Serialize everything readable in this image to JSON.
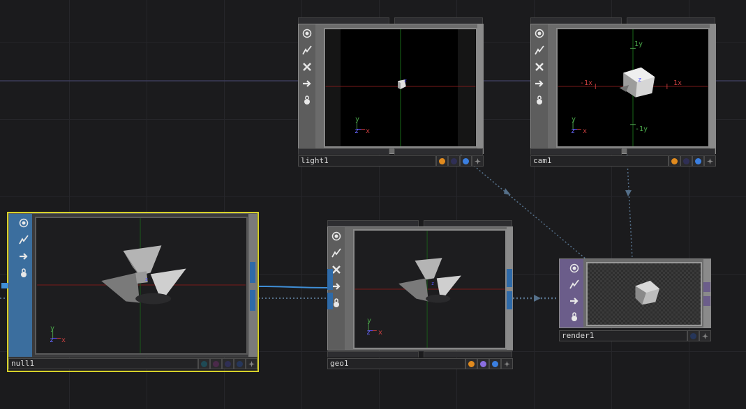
{
  "nodes": {
    "light1": {
      "name": "light1",
      "flags": {
        "colors": [
          "#e08a1e",
          "#2f2f55",
          "#3b7fe0"
        ]
      }
    },
    "cam1": {
      "name": "cam1",
      "flags": {
        "colors": [
          "#e08a1e",
          "#2f2f55",
          "#3b7fe0"
        ]
      }
    },
    "null1": {
      "name": "null1",
      "flags": {
        "colors": [
          "#1f4a55",
          "#4a2a4a",
          "#2f2f55",
          "#26365a"
        ]
      }
    },
    "geo1": {
      "name": "geo1",
      "flags": {
        "colors": [
          "#e08a1e",
          "#8a6ee0",
          "#3b7fe0"
        ]
      }
    },
    "render1": {
      "name": "render1",
      "flags": {
        "colors": [
          "#26365a"
        ]
      }
    }
  },
  "cam_view_labels": {
    "plus_y": "1y",
    "minus_y": "-1y",
    "plus_x": "1x",
    "minus_x": "-1x",
    "axis_z": "z"
  },
  "axis_gizmo": {
    "x": "x",
    "y": "y",
    "z": "z"
  },
  "sidebar_buttons": [
    "viewer-toggle-icon",
    "bypass-icon",
    "cook-off-icon",
    "export-arrow-icon",
    "lock-icon"
  ],
  "colors": {
    "accent_selected": "#d6d12a",
    "wire_blue": "#3f8ed6",
    "comp_render": "#6b5d8a"
  }
}
